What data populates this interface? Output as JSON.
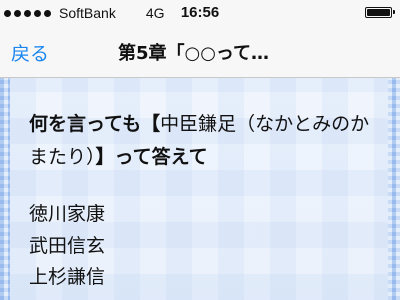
{
  "status_bar": {
    "carrier": "SoftBank",
    "network": "4G",
    "time": "16:56",
    "battery_level": 1.0
  },
  "nav": {
    "back_label": "戻る",
    "title": "第5章「○○って…"
  },
  "question": {
    "part1": "何を言っても【",
    "part2": "中臣鎌足（なかとみのかまたり）",
    "part3": "】って答えて"
  },
  "choices": [
    "徳川家康",
    "武田信玄",
    "上杉謙信"
  ]
}
